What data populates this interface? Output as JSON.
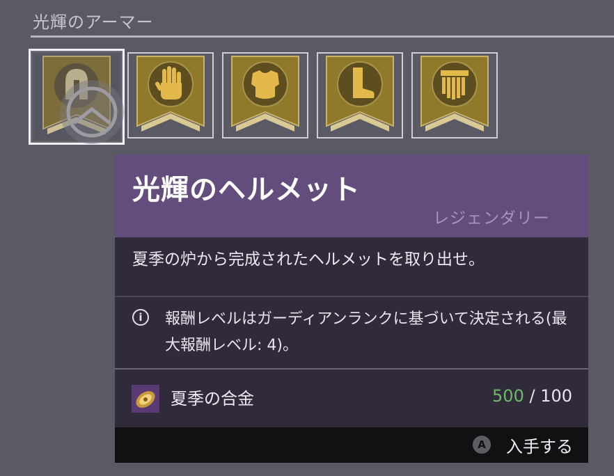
{
  "section": {
    "title": "光輝のアーマー"
  },
  "armor_slots": [
    {
      "name": "helmet",
      "icon": "helmet-icon",
      "selected": true
    },
    {
      "name": "gauntlets",
      "icon": "gauntlet-icon",
      "selected": false
    },
    {
      "name": "chest",
      "icon": "chest-armor-icon",
      "selected": false
    },
    {
      "name": "legs",
      "icon": "boot-icon",
      "selected": false
    },
    {
      "name": "class-item",
      "icon": "class-item-icon",
      "selected": false
    }
  ],
  "tooltip": {
    "item_name": "光輝のヘルメット",
    "rarity": "レジェンダリー",
    "description": "夏季の炉から完成されたヘルメットを取り出せ。",
    "note_icon": "info-icon",
    "note": "報酬レベルはガーディアンランクに基づいて決定される(最大報酬レベル: 4)。",
    "cost": {
      "icon": "summer-alloy-icon",
      "name": "夏季の合金",
      "have": "500",
      "separator": " / ",
      "required": "100"
    },
    "action": {
      "button": "A",
      "label": "入手する"
    }
  },
  "colors": {
    "background": "#595a64",
    "header": "#624d7c",
    "panel": "#302a3b",
    "footer": "#111013",
    "affordable": "#6dbb68",
    "banner_gold": "#8f7a2c"
  }
}
